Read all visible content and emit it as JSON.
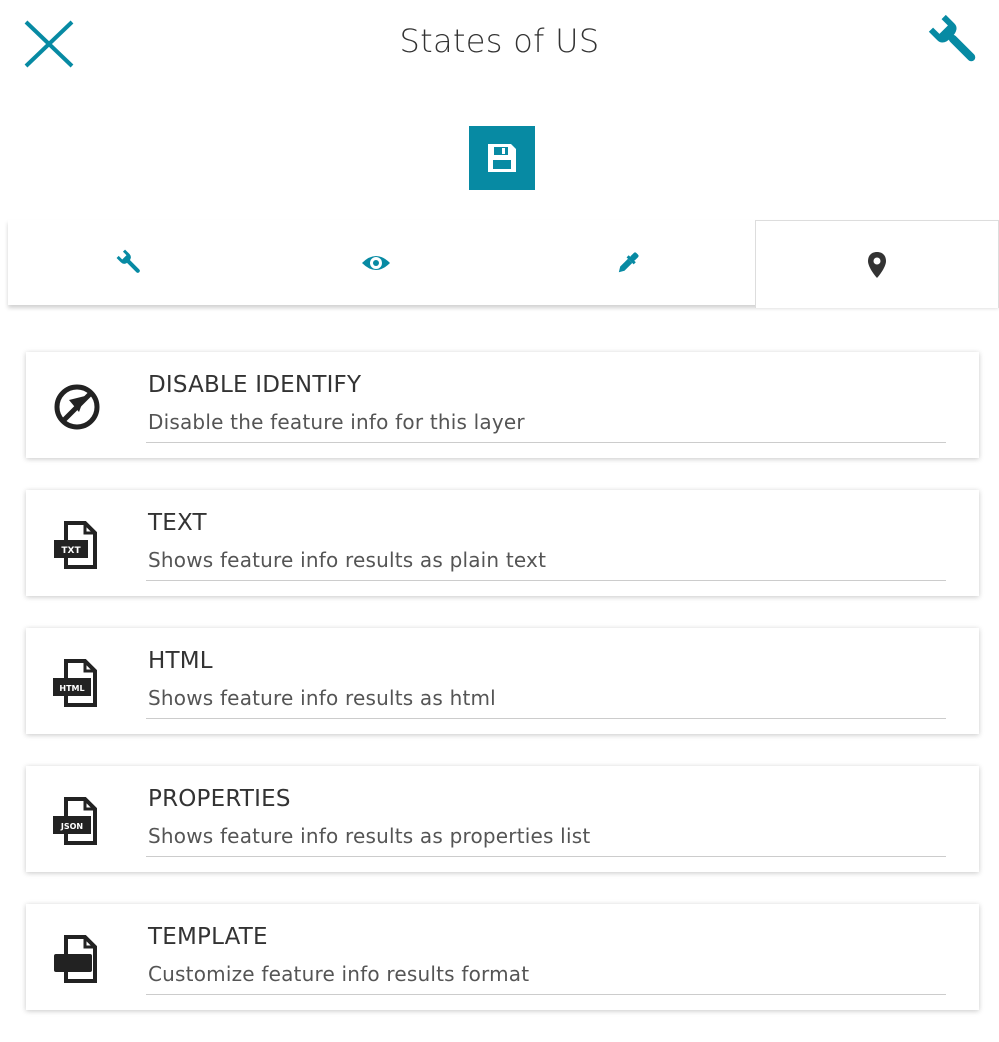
{
  "header": {
    "title": "States of US",
    "close_icon": "close-icon",
    "tools_icon": "wrench-icon"
  },
  "toolbar": {
    "save_icon": "floppy-disk-icon",
    "accent_color": "#078aa3"
  },
  "tabs": [
    {
      "name": "general",
      "icon": "wrench-icon",
      "active": false
    },
    {
      "name": "display",
      "icon": "eye-icon",
      "active": false
    },
    {
      "name": "style",
      "icon": "dropper-icon",
      "active": false
    },
    {
      "name": "feature-info",
      "icon": "map-marker-icon",
      "active": true
    }
  ],
  "options": [
    {
      "icon": "disable-identify-icon",
      "title": "DISABLE IDENTIFY",
      "description": "Disable the feature info for this layer"
    },
    {
      "icon": "txt-file-icon",
      "icon_label": "TXT",
      "title": "TEXT",
      "description": "Shows feature info results as plain text"
    },
    {
      "icon": "html-file-icon",
      "icon_label": "HTML",
      "title": "HTML",
      "description": "Shows feature info results as html"
    },
    {
      "icon": "json-file-icon",
      "icon_label": "JSON",
      "title": "PROPERTIES",
      "description": "Shows feature info results as properties list"
    },
    {
      "icon": "template-file-icon",
      "title": "TEMPLATE",
      "description": "Customize feature info results format"
    }
  ]
}
